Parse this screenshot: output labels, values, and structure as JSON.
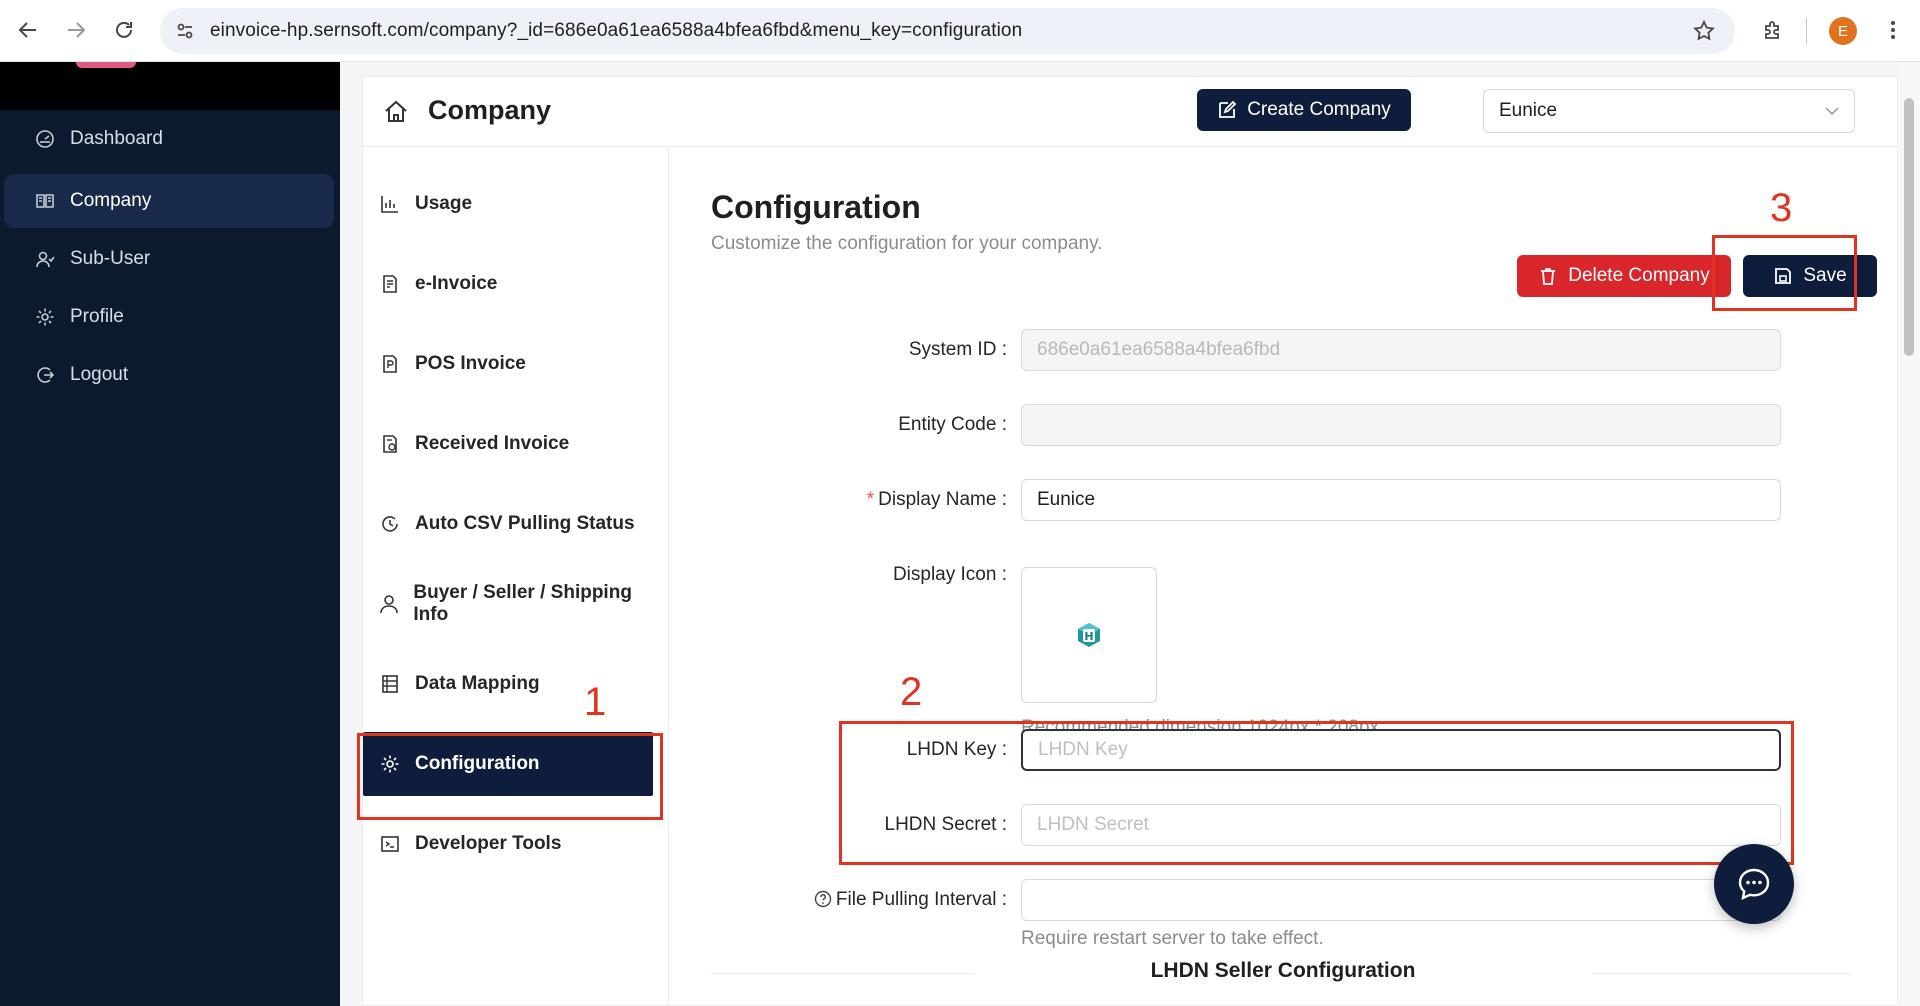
{
  "browser": {
    "url": "einvoice-hp.sernsoft.com/company?_id=686e0a61ea6588a4bfea6fbd&menu_key=configuration",
    "profile_initial": "E",
    "accent_color": "#e2711d"
  },
  "sidebar": {
    "items": [
      {
        "label": "Dashboard",
        "icon": "dashboard-icon",
        "active": false
      },
      {
        "label": "Company",
        "icon": "book-icon",
        "active": true
      },
      {
        "label": "Sub-User",
        "icon": "users-icon",
        "active": false
      },
      {
        "label": "Profile",
        "icon": "gear-icon",
        "active": false
      },
      {
        "label": "Logout",
        "icon": "logout-icon",
        "active": false
      }
    ]
  },
  "header": {
    "title": "Company",
    "create_label": "Create Company",
    "company_select": "Eunice"
  },
  "submenu": {
    "items": [
      {
        "label": "Usage",
        "icon": "bar-chart-icon"
      },
      {
        "label": "e-Invoice",
        "icon": "invoice-icon"
      },
      {
        "label": "POS Invoice",
        "icon": "pos-invoice-icon"
      },
      {
        "label": "Received Invoice",
        "icon": "received-invoice-icon"
      },
      {
        "label": "Auto CSV Pulling Status",
        "icon": "clock-icon"
      },
      {
        "label": "Buyer / Seller / Shipping Info",
        "icon": "user-icon"
      },
      {
        "label": "Data Mapping",
        "icon": "data-mapping-icon"
      },
      {
        "label": "Configuration",
        "icon": "gear-icon"
      },
      {
        "label": "Developer Tools",
        "icon": "terminal-icon"
      }
    ],
    "active": "Configuration"
  },
  "content": {
    "title": "Configuration",
    "subtitle": "Customize the configuration for your company.",
    "delete_label": "Delete Company",
    "save_label": "Save",
    "fields": {
      "system_id": {
        "label": "System ID",
        "value": "686e0a61ea6588a4bfea6fbd"
      },
      "entity_code": {
        "label": "Entity Code",
        "value": ""
      },
      "display_name": {
        "label": "Display Name",
        "value": "Eunice",
        "required": true
      },
      "display_icon": {
        "label": "Display Icon",
        "help": "Recommended dimension 1024px * 208px"
      },
      "lhdn_key": {
        "label": "LHDN Key",
        "placeholder": "LHDN Key"
      },
      "lhdn_secret": {
        "label": "LHDN Secret",
        "placeholder": "LHDN Secret"
      },
      "file_pulling_interval": {
        "label": "File Pulling Interval",
        "value": "",
        "help": "Require restart server to take effect."
      }
    },
    "section_title": "LHDN Seller Configuration"
  },
  "annotations": [
    "1",
    "2",
    "3"
  ],
  "colors": {
    "sidebar_bg": "#0c1a2e",
    "primary_dark": "#0f1d3d",
    "danger": "#d9262b",
    "annotation_red": "#e1331f"
  }
}
